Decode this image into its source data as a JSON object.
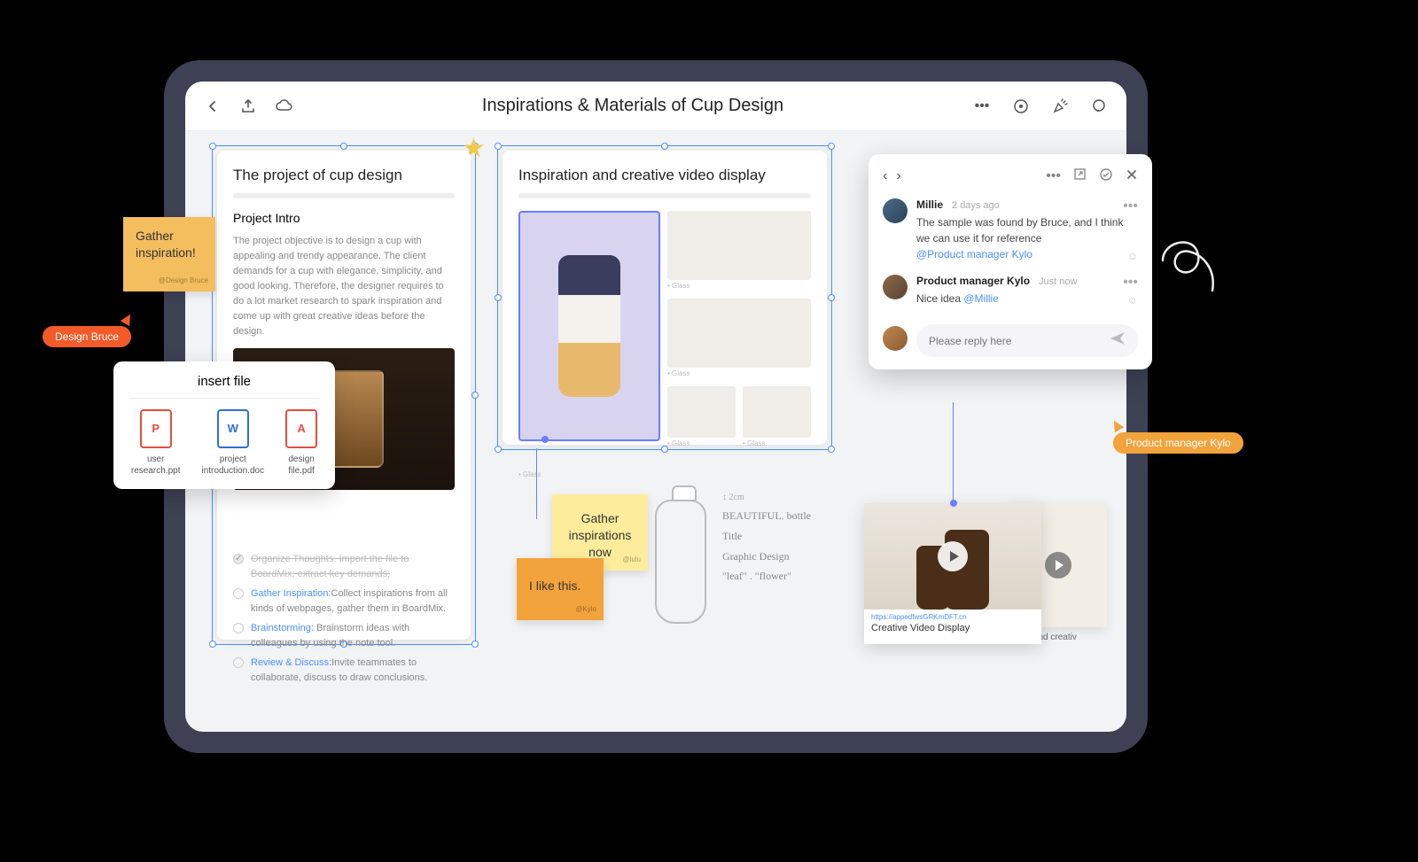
{
  "header": {
    "title": "Inspirations & Materials of Cup Design"
  },
  "card1": {
    "title": "The project of cup design",
    "subtitle": "Project Intro",
    "body": "The project objective is to design a cup with appealing and trendy appearance. The client demands for a cup with elegance, simplicity, and good looking. Therefore, the designer requires to do a lot market research to spark inspiration and come up with great creative ideas before the design.",
    "tasks": [
      {
        "done": true,
        "label": "Organize Thoughts:",
        "text": "Import the file to BoardMix; extract key demands;"
      },
      {
        "done": false,
        "label": "Gather Inspiration:",
        "text": "Collect inspirations from all kinds of webpages, gather them in BoardMix."
      },
      {
        "done": false,
        "label": "Brainstorming:",
        "text": "Brainstorm ideas with colleagues by using the note tool."
      },
      {
        "done": false,
        "label": "Review & Discuss:",
        "text": "Invite teammates to collaborate, discuss to draw conclusions."
      }
    ]
  },
  "card2": {
    "title": "Inspiration and creative video display"
  },
  "stickies": {
    "gather1": {
      "text": "Gather inspiration!",
      "sig": "@Design Bruce"
    },
    "gather2": {
      "text": "Gather inspirations now",
      "sig": "@lulu"
    },
    "like": {
      "text": "I like this.",
      "sig": "@Kylo"
    }
  },
  "cursors": {
    "bruce": "Design Bruce",
    "kylo": "Product manager Kylo"
  },
  "insert": {
    "title": "insert file",
    "files": [
      {
        "type": "ppt",
        "glyph": "P",
        "name": "user\nresearch.ppt"
      },
      {
        "type": "doc",
        "glyph": "W",
        "name": "project\nintroduction.doc"
      },
      {
        "type": "pdf",
        "glyph": "A",
        "name": "design\nfile.pdf"
      }
    ]
  },
  "sketch": {
    "dim": "2cm",
    "lines": [
      "BEAUTIFUL. bottle",
      "Title",
      "Graphic Design",
      "\"leaf\" . \"flower\""
    ]
  },
  "video": {
    "url": "https://appedfwsGRKmDFT.cn",
    "caption": "Creative Video Display",
    "behind_caption": "tion and creativ"
  },
  "comments": {
    "items": [
      {
        "name": "Millie",
        "time": "2 days ago",
        "text": "The sample was found by Bruce, and I think we can use it for reference",
        "mention": "@Product manager Kylo"
      },
      {
        "name": "Product manager Kylo",
        "time": "Just now",
        "text": "Nice idea ",
        "inline_mention": "@Millie"
      }
    ],
    "reply_placeholder": "Please reply here"
  }
}
